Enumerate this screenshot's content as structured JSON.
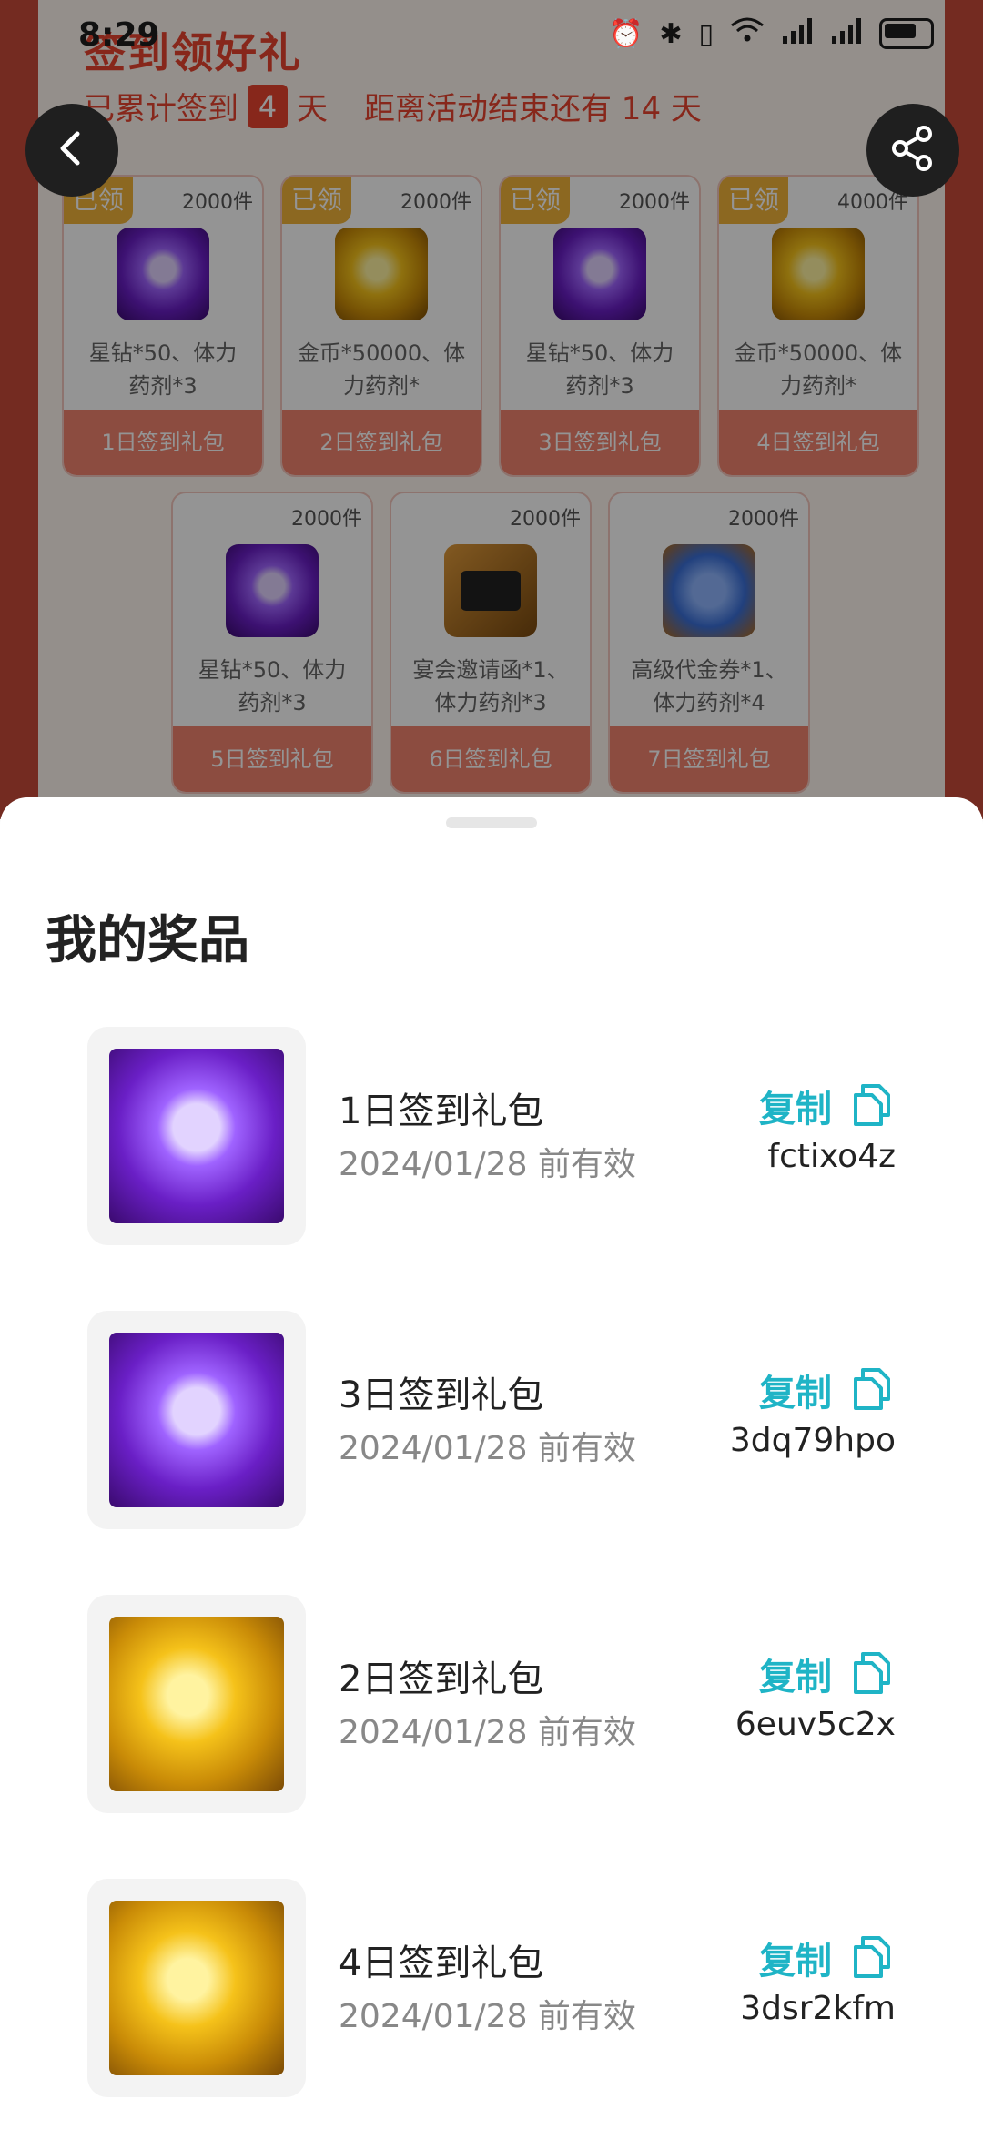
{
  "status_bar": {
    "time": "8:29"
  },
  "background": {
    "title": "签到领好礼",
    "subtitle_prefix": "已累计签到",
    "days": "4",
    "subtitle_suffix": "天",
    "countdown": "距离活动结束还有 14 天",
    "cards": [
      {
        "badge": "已领",
        "qty": "2000件",
        "desc1": "星钻*50、体力",
        "desc2": "药剂*3",
        "label": "1日签到礼包",
        "icon": "gem"
      },
      {
        "badge": "已领",
        "qty": "2000件",
        "desc1": "金币*50000、体",
        "desc2": "力药剂*",
        "label": "2日签到礼包",
        "icon": "coin"
      },
      {
        "badge": "已领",
        "qty": "2000件",
        "desc1": "星钻*50、体力",
        "desc2": "药剂*3",
        "label": "3日签到礼包",
        "icon": "gem"
      },
      {
        "badge": "已领",
        "qty": "4000件",
        "desc1": "金币*50000、体",
        "desc2": "力药剂*",
        "label": "4日签到礼包",
        "icon": "coin"
      },
      {
        "badge": "",
        "qty": "2000件",
        "desc1": "星钻*50、体力",
        "desc2": "药剂*3",
        "label": "5日签到礼包",
        "icon": "gem"
      },
      {
        "badge": "",
        "qty": "2000件",
        "desc1": "宴会邀请函*1、",
        "desc2": "体力药剂*3",
        "label": "6日签到礼包",
        "icon": "invite"
      },
      {
        "badge": "",
        "qty": "2000件",
        "desc1": "高级代金券*1、",
        "desc2": "体力药剂*4",
        "label": "7日签到礼包",
        "icon": "coupon"
      }
    ]
  },
  "sheet": {
    "title": "我的奖品",
    "copy_label": "复制",
    "prizes": [
      {
        "name": "1日签到礼包",
        "valid": "2024/01/28 前有效",
        "code": "fctixo4z",
        "icon": "gem"
      },
      {
        "name": "3日签到礼包",
        "valid": "2024/01/28 前有效",
        "code": "3dq79hpo",
        "icon": "gem"
      },
      {
        "name": "2日签到礼包",
        "valid": "2024/01/28 前有效",
        "code": "6euv5c2x",
        "icon": "coin"
      },
      {
        "name": "4日签到礼包",
        "valid": "2024/01/28 前有效",
        "code": "3dsr2kfm",
        "icon": "coin"
      }
    ]
  },
  "colors": {
    "accent": "#1fb4c6",
    "brand_red": "#e8442f"
  }
}
